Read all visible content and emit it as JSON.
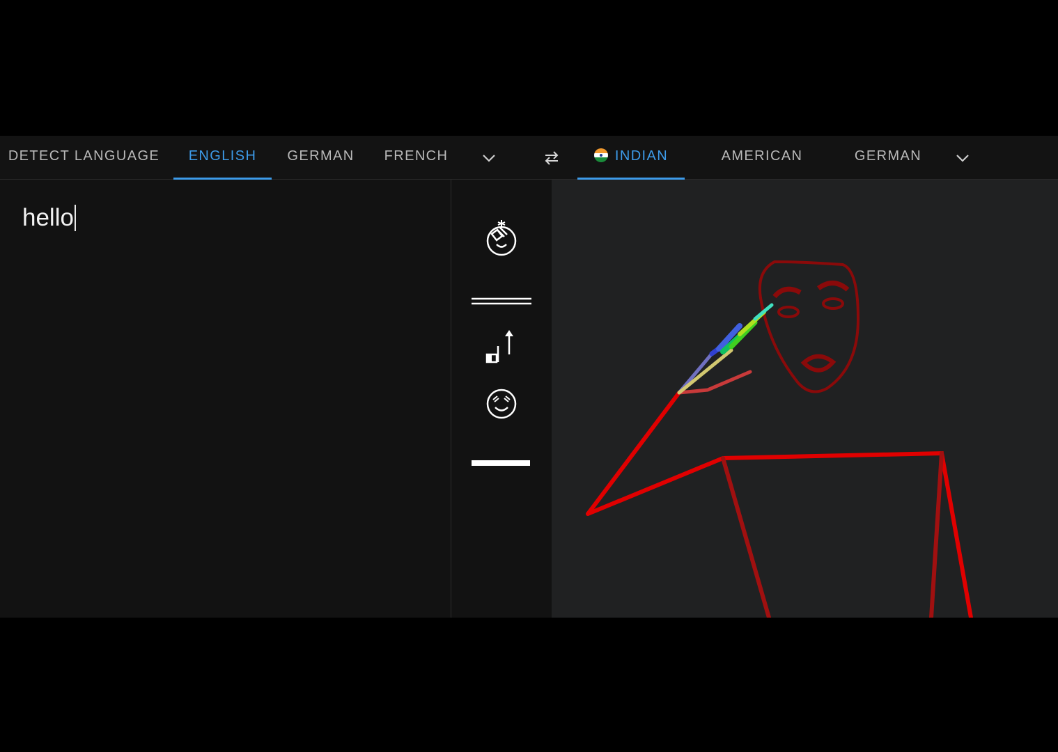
{
  "source_tabs": [
    {
      "label": "DETECT LANGUAGE",
      "active": false
    },
    {
      "label": "ENGLISH",
      "active": true
    },
    {
      "label": "GERMAN",
      "active": false
    },
    {
      "label": "FRENCH",
      "active": false
    }
  ],
  "target_tabs": [
    {
      "label": "INDIAN",
      "active": true,
      "flag": "india-flag"
    },
    {
      "label": "AMERICAN",
      "active": false
    },
    {
      "label": "GERMAN",
      "active": false
    }
  ],
  "source_text": "hello",
  "sign_glyphs": [
    "face-hand-sign-icon",
    "double-line-sign-icon",
    "hand-up-arrow-sign-icon",
    "smiling-face-sign-icon",
    "bar-sign-icon"
  ],
  "colors": {
    "accent": "#3d9be9",
    "figure_body": "#e00000",
    "figure_face": "#8a0a0a"
  },
  "icons": {
    "source_more": "chevron-down-icon",
    "swap": "swap-arrows-icon",
    "target_more": "chevron-down-icon"
  }
}
